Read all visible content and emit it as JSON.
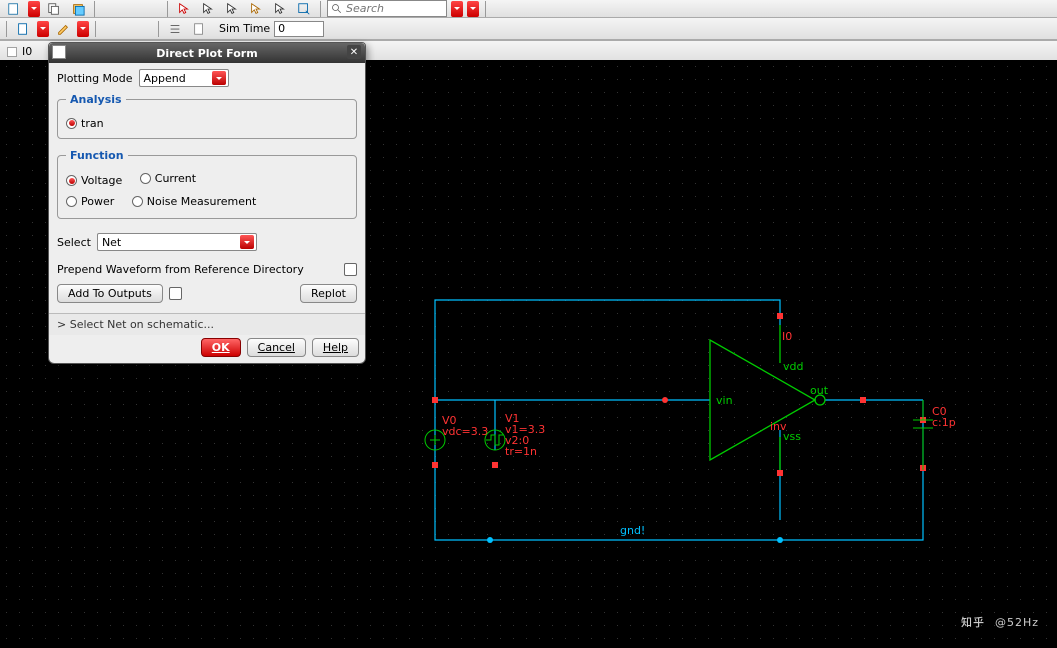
{
  "toolbar": {
    "search_placeholder": "Search",
    "simtime_label": "Sim Time",
    "simtime_value": "0",
    "tab_label": "I0"
  },
  "dialog": {
    "title": "Direct Plot Form",
    "plotting_mode_label": "Plotting Mode",
    "plotting_mode_value": "Append",
    "analysis_legend": "Analysis",
    "analysis_options": {
      "tran": "tran"
    },
    "function_legend": "Function",
    "function_options": {
      "voltage": "Voltage",
      "current": "Current",
      "power": "Power",
      "noise": "Noise Measurement"
    },
    "select_label": "Select",
    "select_value": "Net",
    "prepend_label": "Prepend Waveform from Reference Directory",
    "add_to_outputs": "Add To Outputs",
    "replot": "Replot",
    "status": "> Select Net on schematic...",
    "ok": "OK",
    "cancel": "Cancel",
    "help": "Help"
  },
  "schematic": {
    "v0": {
      "name": "V0",
      "param": "vdc=3.3"
    },
    "v1": {
      "name": "V1",
      "p1": "v1=3.3",
      "p2": "v2:0",
      "p3": "tr=1n"
    },
    "inv": {
      "name": "inv",
      "vin": "vin",
      "out": "out",
      "vdd": "vdd",
      "vss": "vss"
    },
    "cap": {
      "name": "C0",
      "val": "c:1p"
    },
    "i0": "I0",
    "gnd": "gnd!"
  },
  "watermark": {
    "zh": "知乎",
    "handle": "@52Hz"
  }
}
